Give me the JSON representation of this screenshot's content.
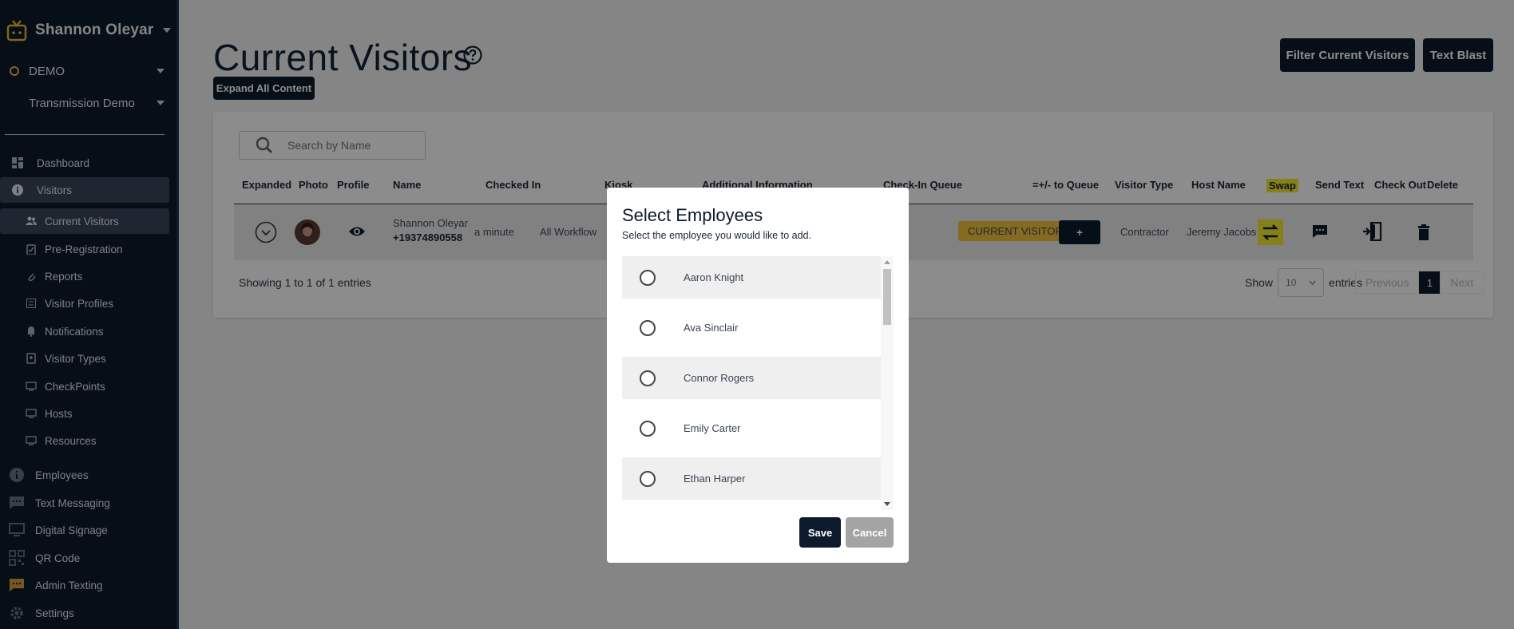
{
  "sidebar": {
    "user_name": "Shannon Oleyar",
    "org": "DEMO",
    "kiosk": "Transmission Demo",
    "items": [
      {
        "label": "Dashboard"
      },
      {
        "label": "Visitors"
      },
      {
        "label": "Current Visitors"
      },
      {
        "label": "Pre-Registration"
      },
      {
        "label": "Reports"
      },
      {
        "label": "Visitor Profiles"
      },
      {
        "label": "Notifications"
      },
      {
        "label": "Visitor Types"
      },
      {
        "label": "CheckPoints"
      },
      {
        "label": "Hosts"
      },
      {
        "label": "Resources"
      },
      {
        "label": "Employees"
      },
      {
        "label": "Text Messaging"
      },
      {
        "label": "Digital Signage"
      },
      {
        "label": "QR Code"
      },
      {
        "label": "Admin Texting"
      },
      {
        "label": "Settings"
      }
    ]
  },
  "header": {
    "title": "Current Visitors",
    "expand_label": "Expand All Content",
    "filter_label": "Filter Current Visitors",
    "blast_label": "Text Blast"
  },
  "table": {
    "search_placeholder": "Search by Name",
    "columns": [
      "Expanded",
      "Photo",
      "Profile",
      "Name",
      "Checked In",
      "Kiosk",
      "Additional Information",
      "Check-In Queue",
      "=+/- to Queue",
      "Visitor Type",
      "Host Name",
      "Swap",
      "Send Text",
      "Check Out",
      "Delete"
    ],
    "row": {
      "name": "Shannon Oleyar",
      "phone": "+19374890558",
      "checked_in": "a minute",
      "kiosk": "All Workflow",
      "queue_badge": "CURRENT VISITORS",
      "queue_button": "+",
      "visitor_type": "Contractor",
      "host_name": "Jeremy Jacobs"
    },
    "showing": "Showing 1 to 1 of 1 entries",
    "show_label": "Show",
    "entries_value": "10",
    "entries_label": "entries",
    "previous": "Previous",
    "current_page": "1",
    "next": "Next"
  },
  "modal": {
    "title": "Select Employees",
    "subtitle": "Select the employee you would like to add.",
    "employees": [
      "Aaron Knight",
      "Ava Sinclair",
      "Connor Rogers",
      "Emily Carter",
      "Ethan Harper"
    ],
    "save_label": "Save",
    "cancel_label": "Cancel"
  },
  "colors": {
    "brand_dark": "#0c1a2c",
    "accent_yellow": "#f1c43c",
    "swap_highlight": "#f5e92d"
  }
}
